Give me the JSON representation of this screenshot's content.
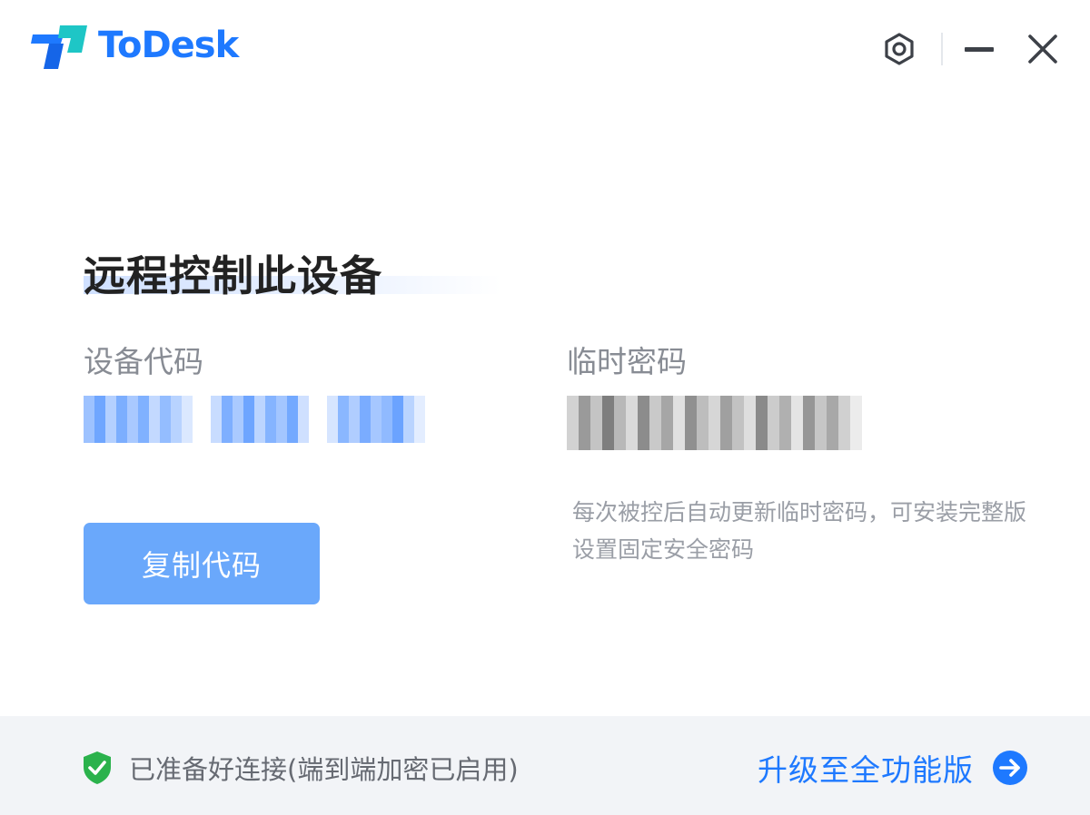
{
  "app": {
    "name": "ToDesk",
    "brand_color": "#1e79ff"
  },
  "window_controls": {
    "settings_icon": "gear-icon",
    "minimize_icon": "minimize-icon",
    "close_icon": "close-icon"
  },
  "main": {
    "title": "远程控制此设备",
    "device_code_label": "设备代码",
    "device_code_value": "",
    "temp_password_label": "临时密码",
    "temp_password_value": "",
    "hint": "每次被控后自动更新临时密码，可安装完整版设置固定安全密码",
    "copy_button_label": "复制代码",
    "accent_button_color": "#6aa8fb"
  },
  "footer": {
    "status_icon": "shield-check-icon",
    "status_text": "已准备好连接(端到端加密已启用)",
    "status_color": "#2bb24c",
    "upgrade_label": "升级至全功能版",
    "upgrade_icon": "arrow-right-circle-icon"
  }
}
